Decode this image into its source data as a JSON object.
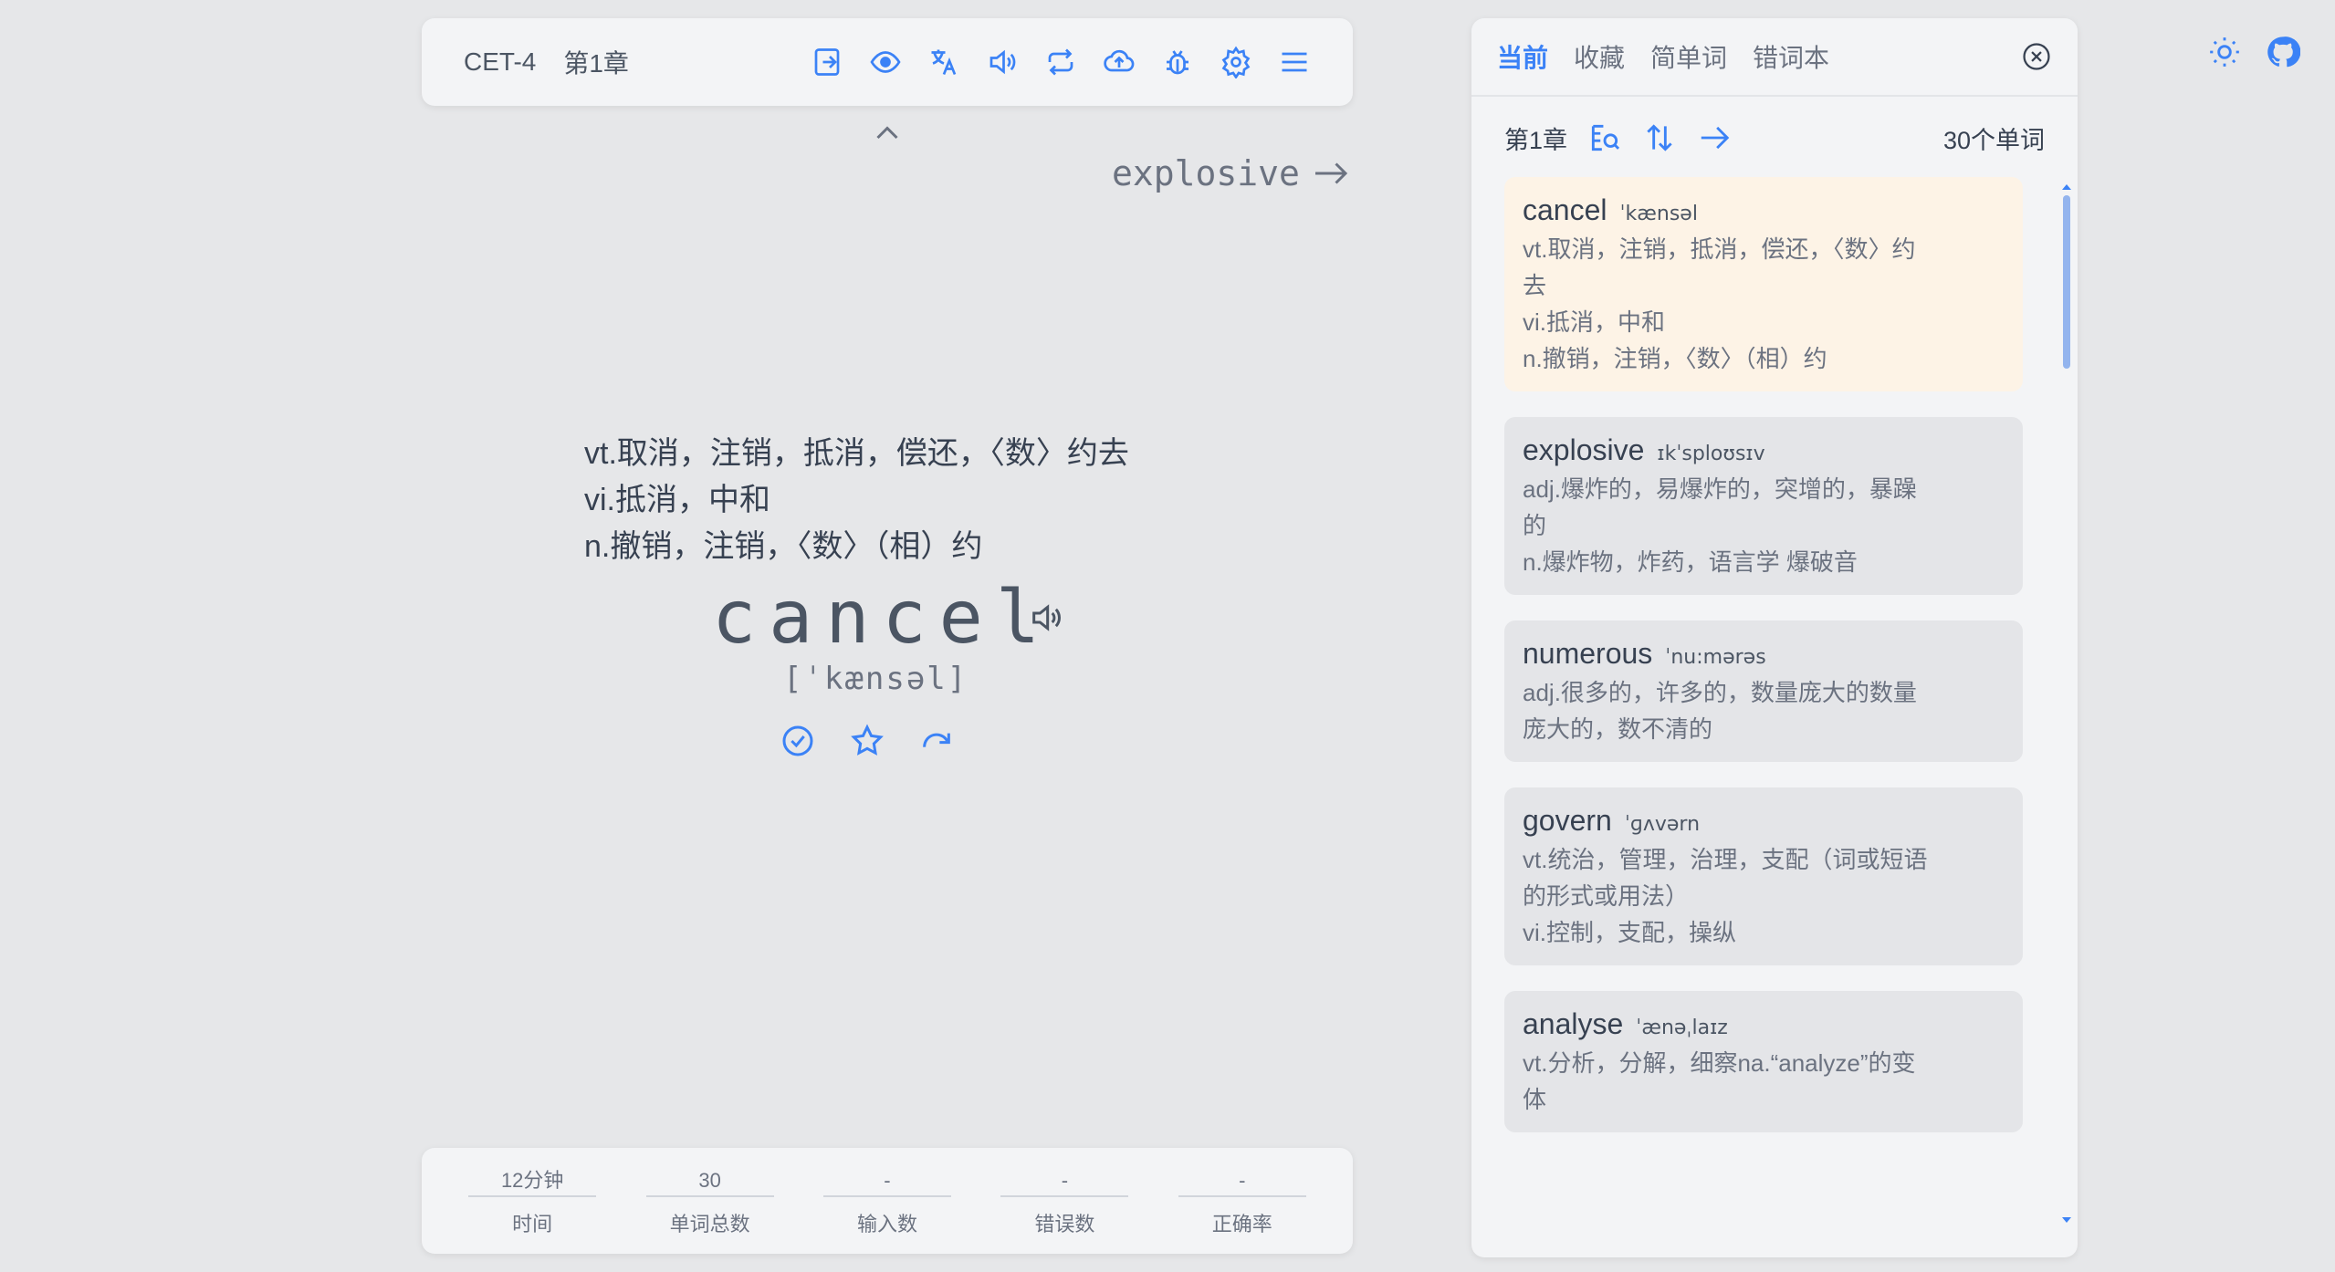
{
  "toolbar": {
    "dict": "CET-4",
    "chapter": "第1章",
    "icons": [
      "exit-icon",
      "eye-icon",
      "translate-icon",
      "speaker-icon",
      "repeat-icon",
      "upload-icon",
      "bug-icon",
      "gear-icon",
      "menu-icon"
    ]
  },
  "next_word": {
    "text": "explosive"
  },
  "current_word": {
    "definitions": [
      "vt.取消，注销，抵消，偿还，〈数〉约去",
      "vi.抵消，中和",
      "n.撤销，注销，〈数〉（相）约"
    ],
    "word": "cancel",
    "phonetic": "[ˈkænsəl]"
  },
  "stats": [
    {
      "value": "12分钟",
      "label": "时间"
    },
    {
      "value": "30",
      "label": "单词总数"
    },
    {
      "value": "-",
      "label": "输入数"
    },
    {
      "value": "-",
      "label": "错误数"
    },
    {
      "value": "-",
      "label": "正确率"
    }
  ],
  "panel": {
    "tabs": [
      "当前",
      "收藏",
      "简单词",
      "错词本"
    ],
    "active_tab": "当前",
    "chapter": "第1章",
    "count": "30个单词",
    "words": [
      {
        "word": "cancel",
        "phonetic": "ˈkænsəl",
        "trans": "vt.取消，注销，抵消，偿还，〈数〉约\n去\nvi.抵消，中和\nn.撤销，注销，〈数〉（相）约",
        "current": true
      },
      {
        "word": "explosive",
        "phonetic": "ɪkˈsploʊsɪv",
        "trans": "adj.爆炸的，易爆炸的，突增的，暴躁\n的\nn.爆炸物，炸药，语言学 爆破音",
        "current": false
      },
      {
        "word": "numerous",
        "phonetic": "ˈnu:mərəs",
        "trans": "adj.很多的，许多的，数量庞大的数量\n庞大的，数不清的",
        "current": false
      },
      {
        "word": "govern",
        "phonetic": "ˈɡʌvərn",
        "trans": "vt.统治，管理，治理，支配（词或短语\n的形式或用法）\nvi.控制，支配，操纵",
        "current": false
      },
      {
        "word": "analyse",
        "phonetic": "ˈænəˌlaɪz",
        "trans": "vt.分析，分解，细察na.“analyze”的变\n体",
        "current": false
      }
    ]
  },
  "colors": {
    "accent": "#3b82f6",
    "current_card": "#fdf3e6"
  }
}
